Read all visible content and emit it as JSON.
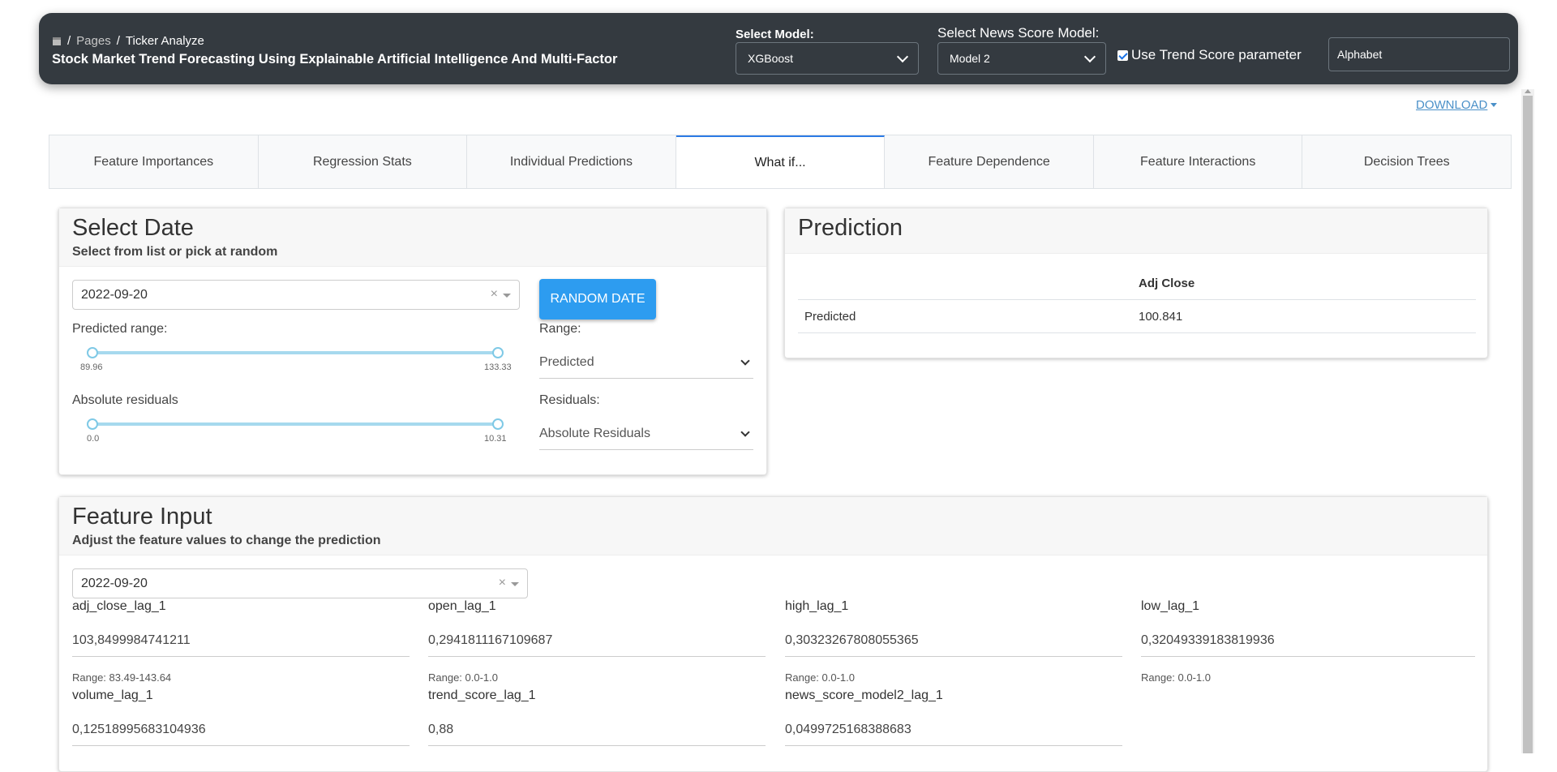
{
  "header": {
    "breadcrumb": {
      "pages": "Pages",
      "current": "Ticker Analyze"
    },
    "title": "Stock Market Trend Forecasting Using Explainable Artificial Intelligence And Multi-Factor",
    "model_label": "Select Model:",
    "model_value": "XGBoost",
    "news_model_label": "Select News Score Model:",
    "news_model_value": "Model 2",
    "trend_checkbox_label": "Use Trend Score parameter",
    "trend_checked": true,
    "ticker_value": "Alphabet"
  },
  "download": {
    "label": "DOWNLOAD"
  },
  "tabs": [
    {
      "label": "Feature Importances",
      "active": false
    },
    {
      "label": "Regression Stats",
      "active": false
    },
    {
      "label": "Individual Predictions",
      "active": false
    },
    {
      "label": "What if...",
      "active": true
    },
    {
      "label": "Feature Dependence",
      "active": false
    },
    {
      "label": "Feature Interactions",
      "active": false
    },
    {
      "label": "Decision Trees",
      "active": false
    }
  ],
  "select_date": {
    "title": "Select Date",
    "subtitle": "Select from list or pick at random",
    "date_value": "2022-09-20",
    "random_button": "Random Date",
    "predicted_range_label": "Predicted range:",
    "predicted_range": {
      "min": "89.96",
      "max": "133.33"
    },
    "abs_residuals_label": "Absolute residuals",
    "abs_residuals": {
      "min": "0.0",
      "max": "10.31"
    },
    "range_label": "Range:",
    "range_value": "Predicted",
    "residuals_label": "Residuals:",
    "residuals_value": "Absolute Residuals"
  },
  "prediction": {
    "title": "Prediction",
    "column_header": "Adj Close",
    "row_label": "Predicted",
    "row_value": "100.841"
  },
  "feature_input": {
    "title": "Feature Input",
    "subtitle": "Adjust the feature values to change the prediction",
    "date_value": "2022-09-20",
    "features": [
      {
        "name": "adj_close_lag_1",
        "value": "103,8499984741211",
        "range": "Range: 83.49-143.64"
      },
      {
        "name": "open_lag_1",
        "value": "0,2941811167109687",
        "range": "Range: 0.0-1.0"
      },
      {
        "name": "high_lag_1",
        "value": "0,30323267808055365",
        "range": "Range: 0.0-1.0"
      },
      {
        "name": "low_lag_1",
        "value": "0,32049339183819936",
        "range": "Range: 0.0-1.0"
      },
      {
        "name": "volume_lag_1",
        "value": "0,12518995683104936",
        "range": ""
      },
      {
        "name": "trend_score_lag_1",
        "value": "0,88",
        "range": ""
      },
      {
        "name": "news_score_model2_lag_1",
        "value": "0,0499725168388683",
        "range": ""
      }
    ]
  }
}
